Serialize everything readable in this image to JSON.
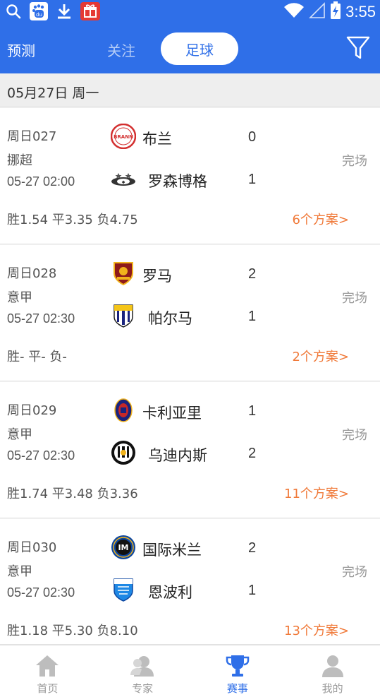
{
  "status_bar": {
    "time": "3:55",
    "baidu_text": "du"
  },
  "header": {
    "tab_predict": "预测",
    "tab_follow": "关注",
    "tab_football": "足球"
  },
  "date_header": "05月27日 周一",
  "matches": [
    {
      "code": "周日027",
      "league": "挪超",
      "time": "05-27 02:00",
      "home": "布兰",
      "home_score": "0",
      "away": "罗森博格",
      "away_score": "1",
      "status": "完场",
      "odds": "胜1.54  平3.35  负4.75",
      "plans": "6个方案>",
      "home_logo_text": "BRANN"
    },
    {
      "code": "周日028",
      "league": "意甲",
      "time": "05-27 02:30",
      "home": "罗马",
      "home_score": "2",
      "away": "帕尔马",
      "away_score": "1",
      "status": "完场",
      "odds": "胜-  平-  负-",
      "plans": "2个方案>",
      "home_logo_text": ""
    },
    {
      "code": "周日029",
      "league": "意甲",
      "time": "05-27 02:30",
      "home": "卡利亚里",
      "home_score": "1",
      "away": "乌迪内斯",
      "away_score": "2",
      "status": "完场",
      "odds": "胜1.74  平3.48  负3.36",
      "plans": "11个方案>",
      "home_logo_text": ""
    },
    {
      "code": "周日030",
      "league": "意甲",
      "time": "05-27 02:30",
      "home": "国际米兰",
      "home_score": "2",
      "away": "恩波利",
      "away_score": "1",
      "status": "完场",
      "odds": "胜1.18  平5.30  负8.10",
      "plans": "13个方案>",
      "home_logo_text": ""
    }
  ],
  "bottom_nav": [
    {
      "label": "首页",
      "icon": "home-icon"
    },
    {
      "label": "专家",
      "icon": "expert-icon"
    },
    {
      "label": "赛事",
      "icon": "trophy-icon"
    },
    {
      "label": "我的",
      "icon": "user-icon"
    }
  ],
  "colors": {
    "primary": "#2f6fe8",
    "accent": "#f07a3a",
    "status": "#999999"
  }
}
